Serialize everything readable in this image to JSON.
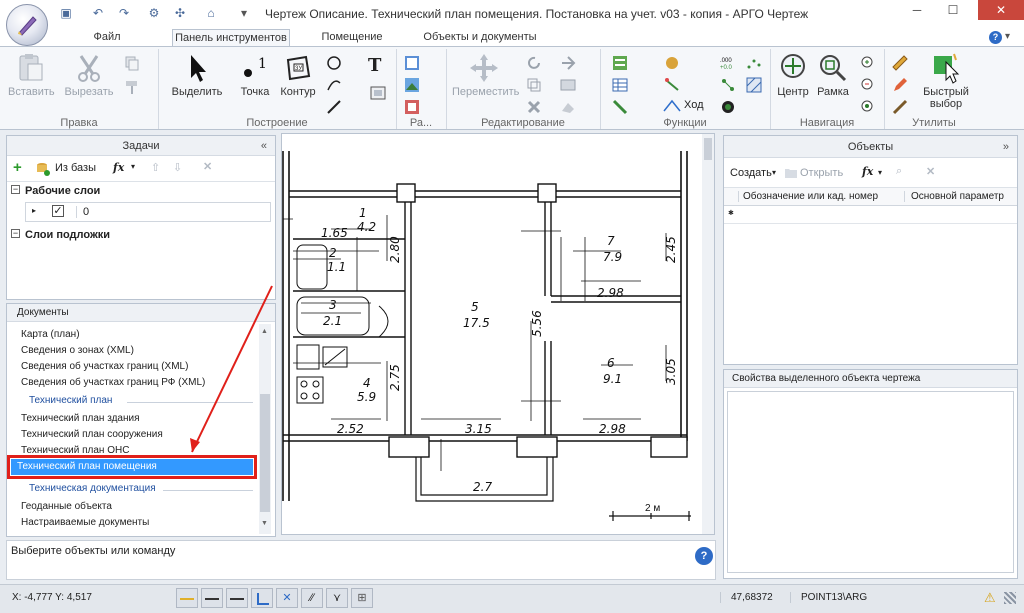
{
  "window": {
    "title": "Чертеж Описание. Технический план помещения. Постановка на учет. v03 - копия - АРГО Чертеж"
  },
  "tabs": [
    {
      "label": "Файл",
      "active": false
    },
    {
      "label": "Панель инструментов",
      "active": true
    },
    {
      "label": "Помещение",
      "active": false
    },
    {
      "label": "Объекты и документы",
      "active": false
    }
  ],
  "ribbon": {
    "groups": {
      "edit": "Правка",
      "build": "Построение",
      "ra": "Ра...",
      "editing": "Редактирование",
      "functions": "Функции",
      "navigation": "Навигация",
      "utilities": "Утилиты"
    },
    "buttons": {
      "paste": "Вставить",
      "cut": "Вырезать",
      "select": "Выделить",
      "point": "Точка",
      "contour": "Контур",
      "move": "Переместить",
      "step": "Ход",
      "center": "Центр",
      "frame": "Рамка",
      "quick_select_1": "Быстрый",
      "quick_select_2": "выбор"
    }
  },
  "tasks_panel": {
    "title": "Задачи",
    "toolbar": {
      "from_db": "Из базы",
      "fx": "fx"
    },
    "work_layers_label": "Рабочие слои",
    "layer_row_value": "0",
    "layer_checked": true,
    "base_layers_label": "Слои подложки"
  },
  "documents_panel": {
    "title": "Документы",
    "items": [
      {
        "kind": "item",
        "label": "Карта (план)"
      },
      {
        "kind": "item",
        "label": "Сведения о зонах (XML)"
      },
      {
        "kind": "item",
        "label": "Сведения об участках границ (XML)"
      },
      {
        "kind": "item",
        "label": "Сведения об участках границ РФ (XML)"
      },
      {
        "kind": "group",
        "label": "Технический план"
      },
      {
        "kind": "item",
        "label": "Технический план здания"
      },
      {
        "kind": "item",
        "label": "Технический план сооружения"
      },
      {
        "kind": "item",
        "label": "Технический план ОНС"
      },
      {
        "kind": "selected",
        "label": "Технический план помещения"
      },
      {
        "kind": "group",
        "label": "Техническая документация"
      },
      {
        "kind": "item",
        "label": "Геоданные объекта"
      },
      {
        "kind": "item",
        "label": "Настраиваемые документы"
      }
    ]
  },
  "command_line": {
    "prompt": "Выберите объекты или команду"
  },
  "drawing": {
    "dims": {
      "d1": "1.65",
      "r1_num": "1",
      "r1_area": "4.2",
      "d280": "2.80",
      "r2_num": "2",
      "r2_area": "1.1",
      "r3_num": "3",
      "r3_area": "2.1",
      "r4_num": "4",
      "r4_area": "5.9",
      "d275": "2.75",
      "d252": "2.52",
      "r5_num": "5",
      "r5_area": "17.5",
      "d556": "5.56",
      "d315": "3.15",
      "r7_num": "7",
      "r7_area": "7.9",
      "d245": "2.45",
      "d298a": "2.98",
      "r6_num": "6",
      "r6_area": "9.1",
      "d305": "3.05",
      "d298b": "2.98",
      "d27": "2.7"
    },
    "scale_label": "2 м"
  },
  "objects_panel": {
    "title": "Объекты",
    "toolbar": {
      "create": "Создать",
      "open": "Открыть",
      "fx": "fx"
    },
    "columns": [
      "Обозначение или кад. номер",
      "Основной параметр"
    ]
  },
  "properties_panel": {
    "title": "Свойства выделенного объекта чертежа"
  },
  "status": {
    "coords": "X: -4,777 Y: 4,517",
    "scale_value": "47,68372",
    "point_mode": "POINT13\\ARG"
  },
  "colors": {
    "accent": "#2e6bc6",
    "selection": "#3399ff",
    "annotation": "#e0201a",
    "close": "#c9473c"
  }
}
